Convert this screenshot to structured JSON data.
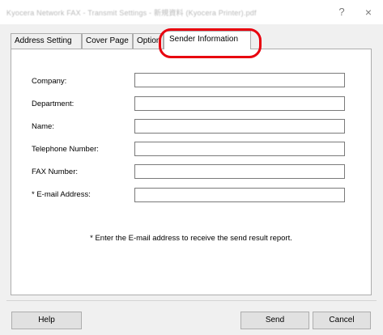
{
  "window": {
    "title": "Kyocera Network FAX - Transmit Settings - 新規資料 (Kyocera Printer).pdf",
    "help_icon": "?",
    "close_icon": "×"
  },
  "tabs": [
    {
      "label": "Address Setting"
    },
    {
      "label": "Cover Page"
    },
    {
      "label": "Option"
    },
    {
      "label": "Sender Information",
      "active": true
    }
  ],
  "form": {
    "fields": [
      {
        "label": "Company:",
        "value": ""
      },
      {
        "label": "Department:",
        "value": ""
      },
      {
        "label": "Name:",
        "value": ""
      },
      {
        "label": "Telephone Number:",
        "value": ""
      },
      {
        "label": "FAX Number:",
        "value": ""
      },
      {
        "label": "* E-mail Address:",
        "value": ""
      }
    ],
    "note": "* Enter the E-mail address to receive the send result report."
  },
  "buttons": {
    "help": "Help",
    "send": "Send",
    "cancel": "Cancel"
  },
  "colors": {
    "highlight": "#e8000e",
    "dialog_bg": "#f0f0f0",
    "panel_bg": "#ffffff"
  }
}
